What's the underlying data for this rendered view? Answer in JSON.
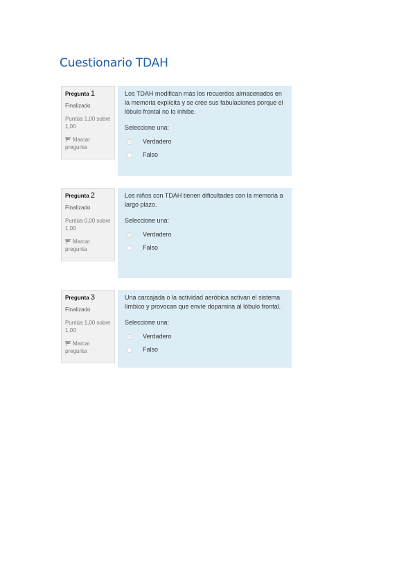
{
  "page": {
    "title": "Cuestionario TDAH"
  },
  "colors": {
    "title": "#1f5ea8",
    "content_bg": "#dcedf6",
    "info_bg": "#f1f1f1"
  },
  "questions": [
    {
      "label": "Pregunta",
      "number": "1",
      "state": "Finalizado",
      "grade": "Puntúa 1,00 sobre 1,00",
      "flag_label": "Marcar pregunta",
      "flag_icon": "flag-icon",
      "text": "Los TDAH modifican más los recuerdos almacenados en la memoria explícita y se cree sus fabulaciones porque el lóbulo frontal no lo inhibe.",
      "prompt": "Seleccione una:",
      "options": [
        "Verdadero",
        "Falso"
      ],
      "selected": "Verdadero"
    },
    {
      "label": "Pregunta",
      "number": "2",
      "state": "Finalizado",
      "grade": "Puntúa 0,00 sobre 1,00",
      "flag_label": "Marcar pregunta",
      "flag_icon": "flag-icon",
      "text": "Los niños con TDAH tienen dificultades con la memoria a largo plazo.",
      "prompt": "Seleccione una:",
      "options": [
        "Verdadero",
        "Falso"
      ],
      "selected": "Verdadero"
    },
    {
      "label": "Pregunta",
      "number": "3",
      "state": "Finalizado",
      "grade": "Puntúa 1,00 sobre 1,00",
      "flag_label": "Marcar pregunta",
      "flag_icon": "flag-icon",
      "text": "Una carcajada o la actividad aeróbica activan el sistema límbico y provocan que envíe dopamina al lóbulo frontal.",
      "prompt": "Seleccione una:",
      "options": [
        "Verdadero",
        "Falso"
      ],
      "selected": "Verdadero"
    }
  ]
}
